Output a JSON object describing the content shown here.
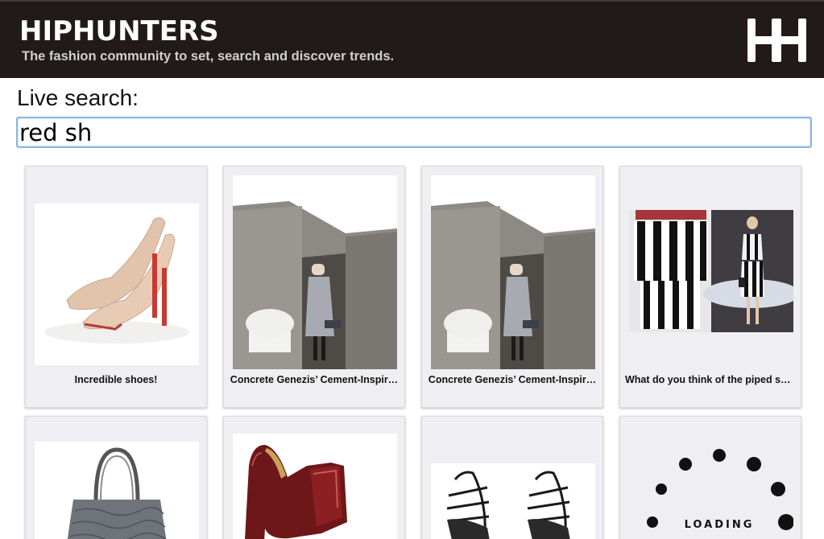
{
  "header": {
    "brand": "HIPHUNTERS",
    "tagline": "The fashion community to set, search and discover trends.",
    "logo_icon": "hh-monogram-icon",
    "background_color": "#211a18"
  },
  "search": {
    "label": "Live search:",
    "value": "red sh",
    "border_color": "#8fb6de"
  },
  "results": [
    {
      "caption": "Incredible shoes!",
      "image": "nude-platform-heels-image"
    },
    {
      "caption": "Concrete Genezis’ Cement-Inspir…",
      "image": "model-at-concrete-bunker-image"
    },
    {
      "caption": "Concrete Genezis’ Cement-Inspir…",
      "image": "model-at-concrete-bunker-image"
    },
    {
      "caption": "What do you think of the piped ski…",
      "image": "striped-skirt-runway-image"
    },
    {
      "caption": "",
      "image": "snakeskin-handbag-image"
    },
    {
      "caption": "",
      "image": "burgundy-patent-shoe-image"
    },
    {
      "caption": "",
      "image": "black-strappy-sandals-image"
    },
    {
      "caption": "",
      "image": "loading-spinner-image"
    }
  ],
  "loading": {
    "label": "LOADING"
  }
}
